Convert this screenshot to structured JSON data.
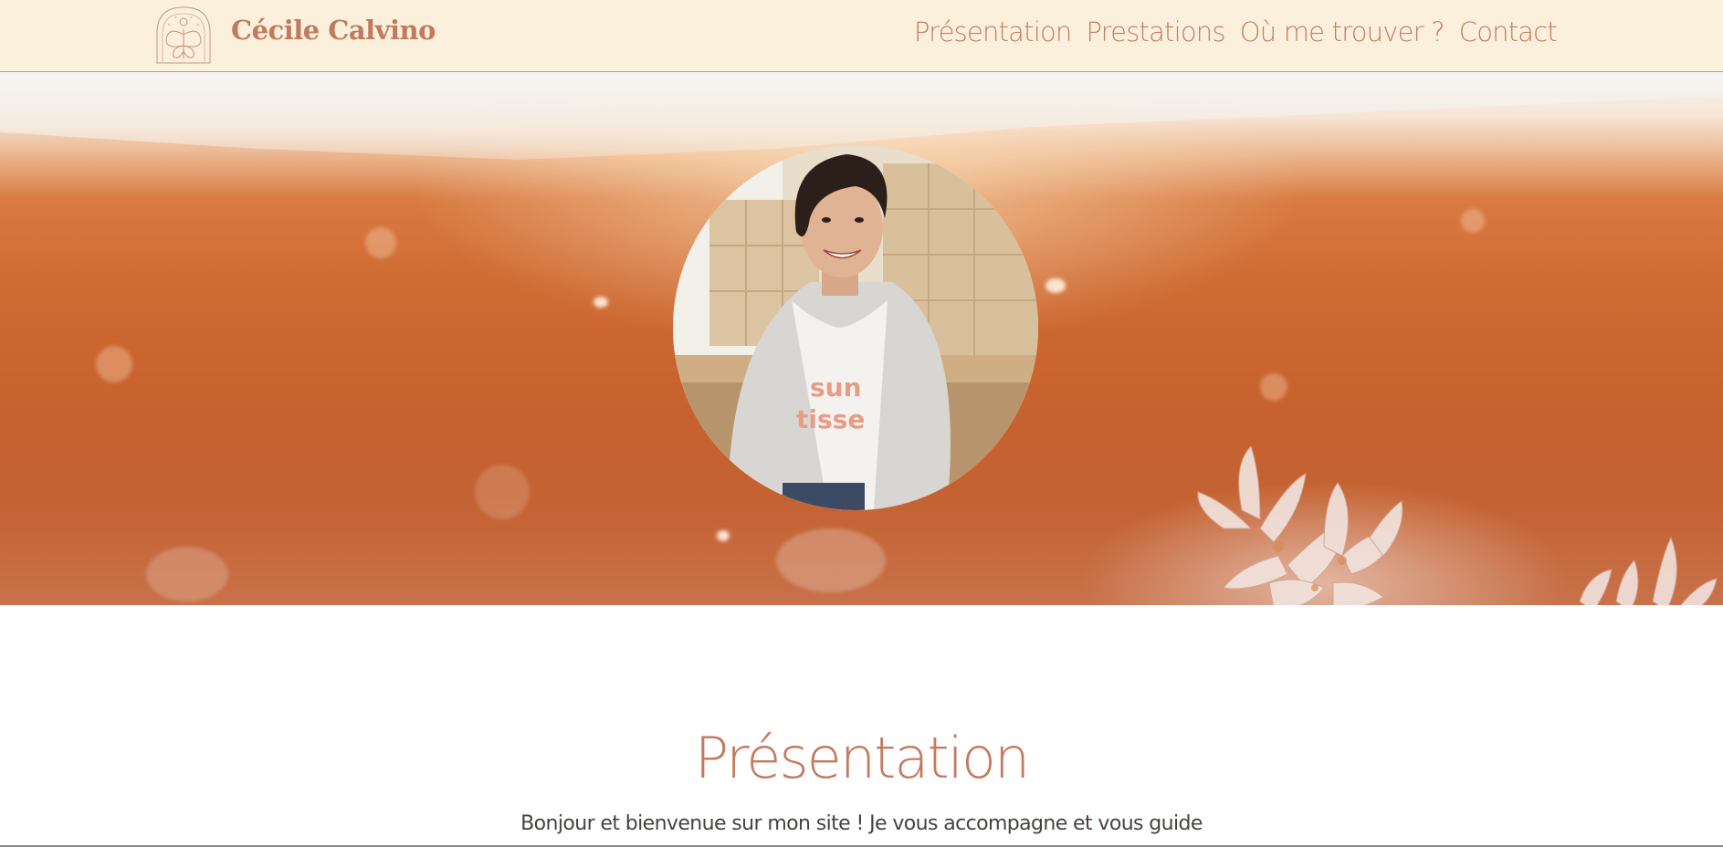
{
  "header": {
    "brand": "Cécile Calvino",
    "logo_icon": "butterfly-arch-icon",
    "nav": [
      {
        "label": "Présentation"
      },
      {
        "label": "Prestations"
      },
      {
        "label": "Où me trouver ?"
      },
      {
        "label": "Contact"
      }
    ]
  },
  "hero": {
    "portrait_icon": "portrait-photo"
  },
  "content": {
    "section_title": "Présentation",
    "intro_text": "Bonjour et bienvenue sur mon site ! Je vous accompagne et vous guide"
  },
  "colors": {
    "header_bg": "#faf0dc",
    "accent": "#c77c62",
    "text": "#4a4040",
    "hero_orange": "#cf6b33"
  }
}
